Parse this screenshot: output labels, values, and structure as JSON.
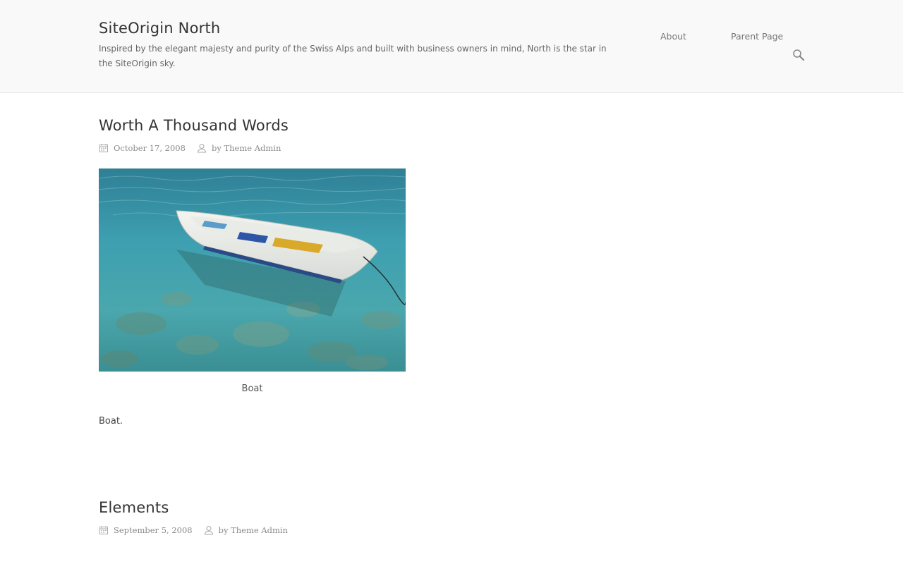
{
  "site": {
    "title": "SiteOrigin North",
    "tagline": "Inspired by the elegant majesty and purity of the Swiss Alps and built with business owners in mind, North is the star in the SiteOrigin sky."
  },
  "nav": {
    "items": [
      {
        "label": "About"
      },
      {
        "label": "Parent Page"
      }
    ],
    "search_icon": "search-icon"
  },
  "posts": [
    {
      "title": "Worth A Thousand Words",
      "date": "October 17, 2008",
      "author": "by Theme Admin",
      "image_icon": "boat-photo",
      "caption": "Boat",
      "body": "Boat."
    },
    {
      "title": "Elements",
      "date": "September 5, 2008",
      "author": "by Theme Admin"
    }
  ],
  "colors": {
    "header_bg": "#f9f9f9",
    "text": "#333333",
    "meta": "#8a8a8a"
  }
}
